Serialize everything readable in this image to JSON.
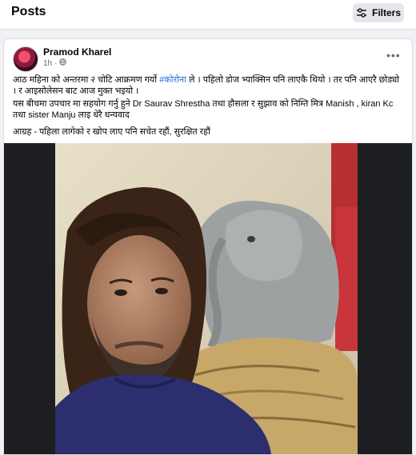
{
  "header": {
    "title": "Posts",
    "filters_label": "Filters",
    "filters_icon": "sliders-icon"
  },
  "post": {
    "author": "Pramod Kharel",
    "time": "1h",
    "audience_icon": "globe-icon",
    "more_icon": "more-options-icon",
    "text": {
      "line1_before": "आठ महिना को अन्तरमा २ चोटि आक्रमण गर्यो ",
      "hashtag": "#कोरोना",
      "line1_after": " ले । पहिलो डोज भ्याक्सिन पनि लाएकै थियो । तर पनि आएरै छोड्यो । र आइसोलेसन बाट आज मुक्त भइयो ।",
      "line2": "यस बीचमा उपचार मा सहयोग गर्नु हुने Dr Saurav Shrestha तथा हौसला र सुझाव को निम्ति मित्र Manish , kiran Kc तथा sister Manju लाइ धेरै धन्यवाद",
      "line3": "आग्रह - पहिला लागेको र खोप लाए पनि सचेत रहौं, सुरक्षित रहौं"
    }
  },
  "colors": {
    "hashtag": "#216fdb",
    "card_bg": "#ffffff",
    "page_bg": "#f0f2f5"
  }
}
